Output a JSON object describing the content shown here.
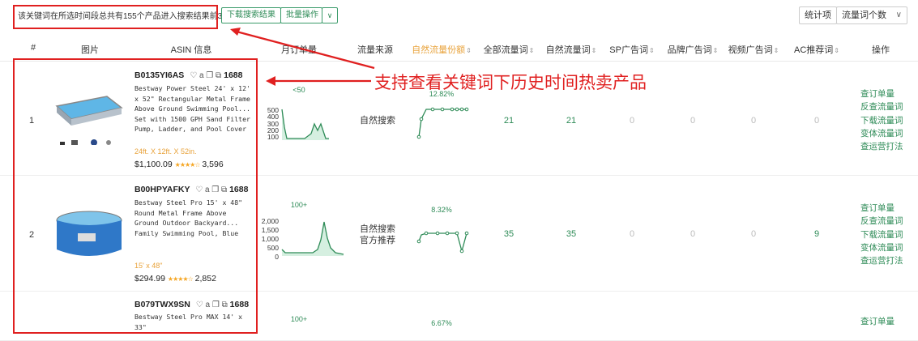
{
  "toolbar": {
    "summary": "该关键词在所选时间段总共有155个产品进入搜索结果前3页",
    "download_label": "下载搜索结果",
    "batch_label": "批量操作",
    "batch_arrow": "∨",
    "stat_label": "统计项",
    "stat_value": "流量词个数",
    "stat_chevron": "∨"
  },
  "headers": {
    "index": "#",
    "image": "图片",
    "asin": "ASIN 信息",
    "monthly_orders": "月订单量",
    "traffic_source": "流量来源",
    "natural_share": "自然流量份额",
    "all_kw": "全部流量词",
    "natural_kw": "自然流量词",
    "sp_kw": "SP广告词",
    "brand_kw": "品牌广告词",
    "video_kw": "视频广告词",
    "ac_kw": "AC推荐词",
    "ops": "操作",
    "sort_icon": "⇕"
  },
  "annotation": "支持查看关键词下历史时间热卖产品",
  "asin_icons": "♡ a ❐ ⧉",
  "rows": [
    {
      "index": "1",
      "asin": "B0135YI6AS",
      "tag": "1688",
      "title": "Bestway Power Steel 24' x 12' x 52\" Rectangular Metal Frame Above Ground Swimming Pool... Set with 1500 GPH Sand Filter Pump, Ladder, and Pool Cover",
      "spec": "24ft. X 12ft. X 52in.",
      "price": "$1,100.09",
      "stars": "★★★★☆",
      "reviews": "3,596",
      "orders_label": "<50",
      "y_ticks": [
        "500",
        "400",
        "300",
        "200",
        "100"
      ],
      "source": [
        "自然搜索"
      ],
      "share": "12.82%",
      "all_kw": "21",
      "natural_kw": "21",
      "sp_kw": "0",
      "brand_kw": "0",
      "video_kw": "0",
      "ac_kw": "0"
    },
    {
      "index": "2",
      "asin": "B00HPYAFKY",
      "tag": "1688",
      "title": "Bestway Steel Pro 15' x 48\" Round Metal Frame Above Ground Outdoor Backyard... Family Swimming Pool, Blue",
      "spec": "15' x 48\"",
      "price": "$294.99",
      "stars": "★★★★☆",
      "reviews": "2,852",
      "orders_label": "100+",
      "y_ticks": [
        "2,000",
        "1,500",
        "1,000",
        "500",
        "0"
      ],
      "source": [
        "自然搜索",
        "官方推荐"
      ],
      "share": "8.32%",
      "all_kw": "35",
      "natural_kw": "35",
      "sp_kw": "0",
      "brand_kw": "0",
      "video_kw": "0",
      "ac_kw": "9"
    },
    {
      "index": "3",
      "asin": "B079TWX9SN",
      "tag": "1688",
      "title": "Bestway Steel Pro MAX 14' x 33\"",
      "orders_label": "100+",
      "share": "6.67%"
    }
  ],
  "ops": [
    "查订单量",
    "反查流量词",
    "下载流量词",
    "变体流量词",
    "查运营打法"
  ],
  "colors": {
    "accent": "#2e8b57",
    "highlight": "#e8a23a",
    "annotation": "#e02020"
  }
}
